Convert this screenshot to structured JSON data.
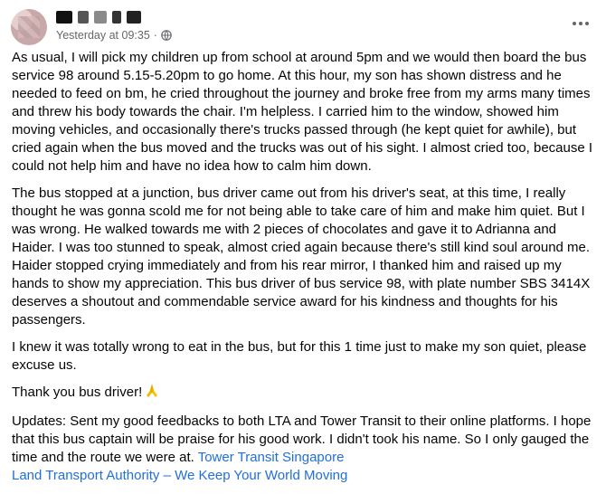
{
  "post": {
    "timestamp": "Yesterday at 09:35",
    "separator": "·",
    "paragraphs": [
      "As usual, I will pick my children up from school at around 5pm and we would then board the bus service 98 around 5.15-5.20pm to go home. At this hour, my son has shown distress and he needed to feed on bm, he cried throughout the journey and broke free from my arms many times and threw his body towards the chair. I'm helpless. I carried him to the window, showed him moving vehicles, and occasionally there's trucks passed through (he kept quiet for awhile), but cried again when the bus moved and the trucks was out of his sight. I almost cried too, because I could not help him and have no idea how to calm him down.",
      "The bus stopped at a junction, bus driver came out from his driver's seat, at this time, I really thought he was gonna scold me for not being able to take care of him and make him quiet. But I was wrong. He walked towards me with 2 pieces of chocolates and gave it to Adrianna and Haider. I was too stunned to speak, almost cried again because there's still kind soul around me. Haider stopped crying immediately and from his rear mirror, I thanked him and raised up my hands to show my appreciation. This bus driver of bus service 98, with plate number SBS 3414X deserves a shoutout and commendable service award for his kindness and thoughts for his passengers.",
      "I knew it was totally wrong to eat in the bus, but for this 1 time just to make my son quiet, please excuse us.",
      "Thank you bus driver!"
    ],
    "update_text": "Updates: Sent my good feedbacks to both LTA and Tower Transit to their online platforms. I hope that this bus captain will be praise for his good work. I didn't took his name. So I only gauged the time and the route we were at.",
    "links": [
      "Tower Transit Singapore",
      "Land Transport Authority – We Keep Your World Moving"
    ],
    "icons": {
      "privacy": "globe-icon",
      "more": "more-options-icon",
      "emoji": "folded-hands-emoji"
    },
    "colors": {
      "link": "#216fdb",
      "meta": "#65676b",
      "text": "#050505"
    }
  }
}
